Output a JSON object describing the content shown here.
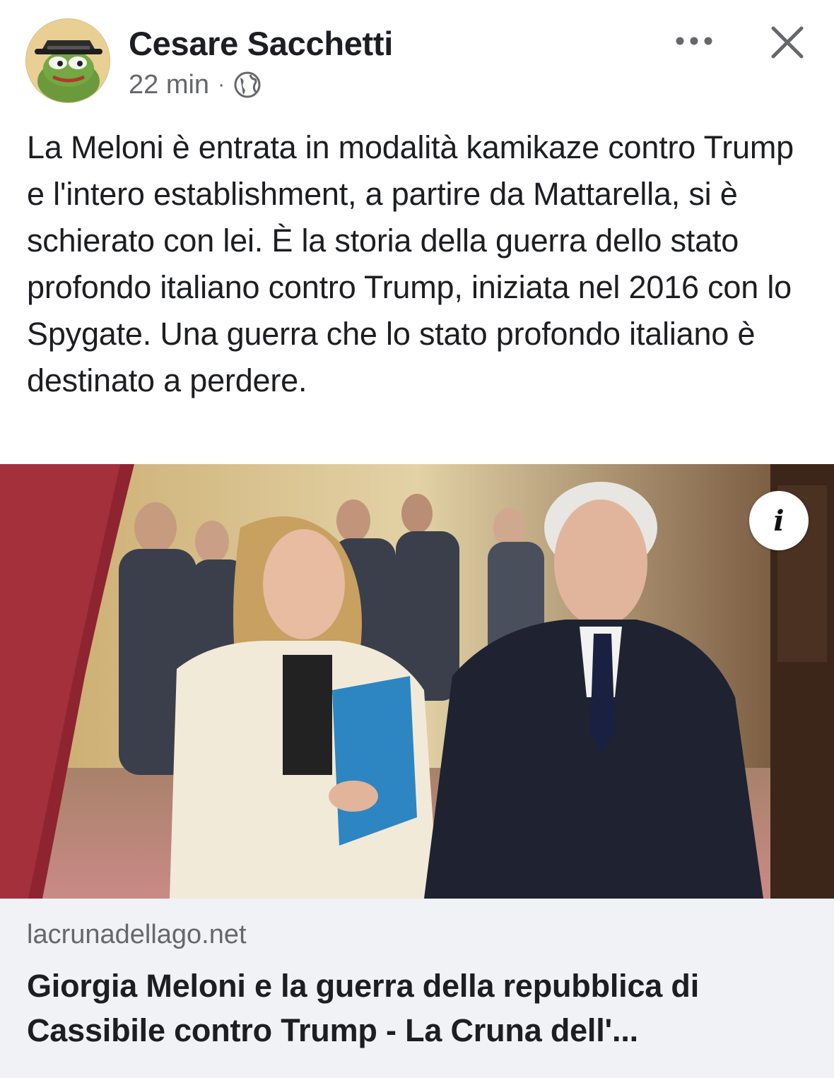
{
  "post": {
    "author": "Cesare Sacchetti",
    "time": "22 min",
    "separator": "·",
    "audience_icon": "globe-icon",
    "text": "La Meloni è entrata in modalità kamikaze contro Trump e l'intero establishment, a partire da Mattarella, si è schierato con lei. È la storia della guerra dello stato profondo italiano contro Trump, iniziata nel 2016 con lo Spygate. Una guerra che lo stato profondo italiano è destinato a perdere."
  },
  "actions": {
    "more_icon": "more-options-icon",
    "close_icon": "close-icon"
  },
  "image": {
    "info_label": "i"
  },
  "link_preview": {
    "domain": "lacrunadellago.net",
    "title": "Giorgia Meloni e la guerra della repubblica di Cassibile contro Trump - La Cruna dell'..."
  },
  "colors": {
    "text": "#1c1e21",
    "secondary": "#65676b",
    "card_bg": "#f0f2f5"
  }
}
